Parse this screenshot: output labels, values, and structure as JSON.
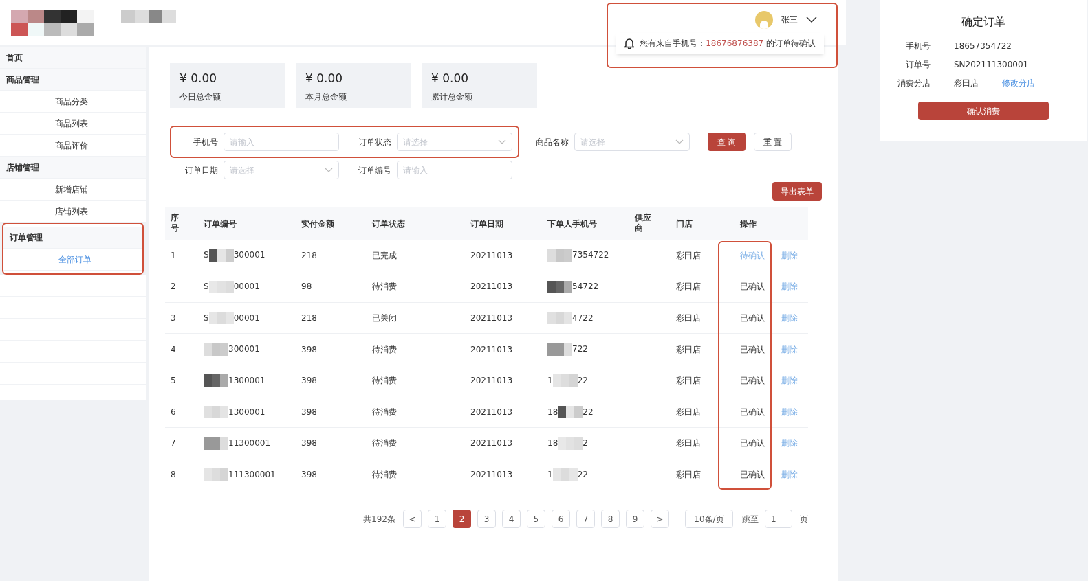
{
  "sidebar": {
    "items": [
      {
        "label": "首页",
        "kind": "group",
        "selected": false
      },
      {
        "label": "商品管理",
        "kind": "group",
        "selected": false
      },
      {
        "label": "商品分类",
        "kind": "item",
        "selected": false
      },
      {
        "label": "商品列表",
        "kind": "item",
        "selected": false
      },
      {
        "label": "商品评价",
        "kind": "item",
        "selected": false
      },
      {
        "label": "店铺管理",
        "kind": "group",
        "selected": false
      },
      {
        "label": "新增店铺",
        "kind": "item",
        "selected": false
      },
      {
        "label": "店铺列表",
        "kind": "item",
        "selected": false
      },
      {
        "label": "订单管理",
        "kind": "group",
        "selected": false,
        "highlighted": true
      },
      {
        "label": "全部订单",
        "kind": "item",
        "selected": true,
        "highlighted": true
      }
    ]
  },
  "header": {
    "user": "张三",
    "notification": {
      "before": "您有来自手机号：",
      "phone": "18676876387",
      "after": " 的订单待确认"
    }
  },
  "stats": [
    {
      "amount": "¥ 0.00",
      "label": "今日总金额"
    },
    {
      "amount": "¥ 0.00",
      "label": "本月总金额"
    },
    {
      "amount": "¥ 0.00",
      "label": "累计总金额"
    }
  ],
  "filters": [
    {
      "label": "手机号",
      "placeholder": "请输入",
      "kind": "input",
      "highlighted": true
    },
    {
      "label": "订单状态",
      "placeholder": "请选择",
      "kind": "select",
      "highlighted": true
    },
    {
      "label": "商品名称",
      "placeholder": "请选择",
      "kind": "select",
      "highlighted": false
    },
    {
      "label": "订单日期",
      "placeholder": "请选择",
      "kind": "select",
      "highlighted": false
    },
    {
      "label": "订单编号",
      "placeholder": "请输入",
      "kind": "input",
      "highlighted": false
    }
  ],
  "search_button": "查 询",
  "reset_button": "重 置",
  "export_button": "导出表单",
  "table": {
    "columns": [
      "序号",
      "订单编号",
      "实付金额",
      "订单状态",
      "订单日期",
      "下单人手机号",
      "供应商",
      "门店",
      "操作"
    ],
    "rows": [
      {
        "index": "1",
        "order_start": "S",
        "order_end": "300001",
        "amount": "218",
        "status": "已完成",
        "date": "20211013",
        "phone_start": "",
        "phone_end": "7354722",
        "store": "彩田店",
        "action": "待确认",
        "action_pending": true,
        "delete": "删除"
      },
      {
        "index": "2",
        "order_start": "S",
        "order_end": "00001",
        "amount": "98",
        "status": "待消费",
        "date": "20211013",
        "phone_start": "",
        "phone_end": "54722",
        "store": "彩田店",
        "action": "已确认",
        "action_pending": false,
        "delete": "删除"
      },
      {
        "index": "3",
        "order_start": "S",
        "order_end": "00001",
        "amount": "218",
        "status": "已关闭",
        "date": "20211013",
        "phone_start": "",
        "phone_end": "4722",
        "store": "彩田店",
        "action": "已确认",
        "action_pending": false,
        "delete": "删除"
      },
      {
        "index": "4",
        "order_start": "",
        "order_end": "300001",
        "amount": "398",
        "status": "待消费",
        "date": "20211013",
        "phone_start": "",
        "phone_end": "722",
        "store": "彩田店",
        "action": "已确认",
        "action_pending": false,
        "delete": "删除"
      },
      {
        "index": "5",
        "order_start": "",
        "order_end": "1300001",
        "amount": "398",
        "status": "待消费",
        "date": "20211013",
        "phone_start": "1",
        "phone_end": "22",
        "store": "彩田店",
        "action": "已确认",
        "action_pending": false,
        "delete": "删除"
      },
      {
        "index": "6",
        "order_start": "",
        "order_end": "1300001",
        "amount": "398",
        "status": "待消费",
        "date": "20211013",
        "phone_start": "18",
        "phone_end": "22",
        "store": "彩田店",
        "action": "已确认",
        "action_pending": false,
        "delete": "删除"
      },
      {
        "index": "7",
        "order_start": "",
        "order_end": "11300001",
        "amount": "398",
        "status": "待消费",
        "date": "20211013",
        "phone_start": "18",
        "phone_end": "2",
        "store": "彩田店",
        "action": "已确认",
        "action_pending": false,
        "delete": "删除"
      },
      {
        "index": "8",
        "order_start": "",
        "order_end": "111300001",
        "amount": "398",
        "status": "待消费",
        "date": "20211013",
        "phone_start": "1",
        "phone_end": "22",
        "store": "彩田店",
        "action": "已确认",
        "action_pending": false,
        "delete": "删除"
      }
    ]
  },
  "pagination": {
    "total": "共192条",
    "prev": "<",
    "next": ">",
    "pages": [
      {
        "label": "1",
        "selected": false
      },
      {
        "label": "2",
        "selected": true
      },
      {
        "label": "3",
        "selected": false
      },
      {
        "label": "4",
        "selected": false
      },
      {
        "label": "5",
        "selected": false
      },
      {
        "label": "6",
        "selected": false
      },
      {
        "label": "7",
        "selected": false
      },
      {
        "label": "8",
        "selected": false
      },
      {
        "label": "9",
        "selected": false
      }
    ],
    "page_size": "10条/页",
    "jump_label": "跳至",
    "jump_value": "1",
    "page_suffix": "页"
  },
  "confirm_panel": {
    "title": "确定订单",
    "fields": [
      {
        "label": "手机号",
        "value": "18657354722"
      },
      {
        "label": "订单号",
        "value": "SN202111300001"
      },
      {
        "label": "消费分店",
        "value": "彩田店",
        "link": "修改分店"
      }
    ],
    "button": "确认消费"
  }
}
